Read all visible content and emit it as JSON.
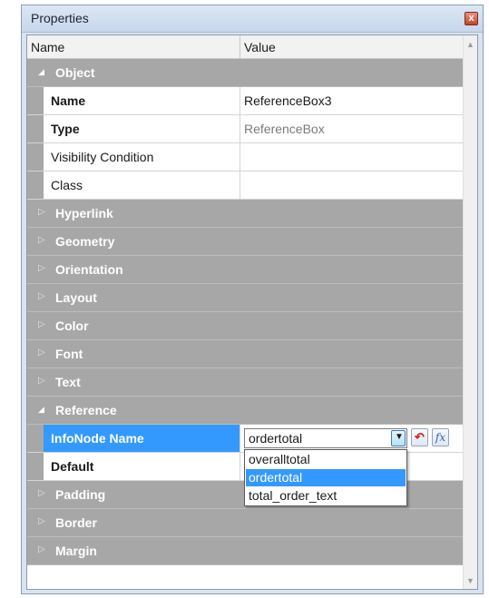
{
  "window": {
    "title": "Properties",
    "close_label": "x"
  },
  "header": {
    "name_col": "Name",
    "value_col": "Value"
  },
  "rows": [
    {
      "kind": "cat",
      "label": "Object",
      "expanded": true
    },
    {
      "kind": "prop",
      "name": "Name",
      "bold": true,
      "value": "ReferenceBox3"
    },
    {
      "kind": "prop",
      "name": "Type",
      "bold": true,
      "value": "ReferenceBox",
      "value_gray": true
    },
    {
      "kind": "prop",
      "name": "Visibility Condition",
      "bold": false,
      "value": ""
    },
    {
      "kind": "prop",
      "name": "Class",
      "bold": false,
      "value": ""
    },
    {
      "kind": "cat",
      "label": "Hyperlink",
      "expanded": false
    },
    {
      "kind": "cat",
      "label": "Geometry",
      "expanded": false
    },
    {
      "kind": "cat",
      "label": "Orientation",
      "expanded": false
    },
    {
      "kind": "cat",
      "label": "Layout",
      "expanded": false
    },
    {
      "kind": "cat",
      "label": "Color",
      "expanded": false
    },
    {
      "kind": "cat",
      "label": "Font",
      "expanded": false
    },
    {
      "kind": "cat",
      "label": "Text",
      "expanded": false
    },
    {
      "kind": "cat",
      "label": "Reference",
      "expanded": true
    },
    {
      "kind": "prop",
      "name": "InfoNode Name",
      "bold": true,
      "selected": true,
      "combo": "ordertotal"
    },
    {
      "kind": "prop",
      "name": "Default",
      "bold": true,
      "value": ""
    },
    {
      "kind": "cat",
      "label": "Padding",
      "expanded": false
    },
    {
      "kind": "cat",
      "label": "Border",
      "expanded": false
    },
    {
      "kind": "cat",
      "label": "Margin",
      "expanded": false
    }
  ],
  "dropdown": {
    "options": [
      "overalltotal",
      "ordertotal",
      "total_order_text"
    ],
    "highlighted": "ordertotal"
  },
  "icons": {
    "reset": "reset-undo-icon",
    "fx": "formula-fx-icon",
    "fx_glyph": "fx"
  },
  "colors": {
    "category_bg": "#a7a7a7",
    "selection": "#3399ff"
  }
}
